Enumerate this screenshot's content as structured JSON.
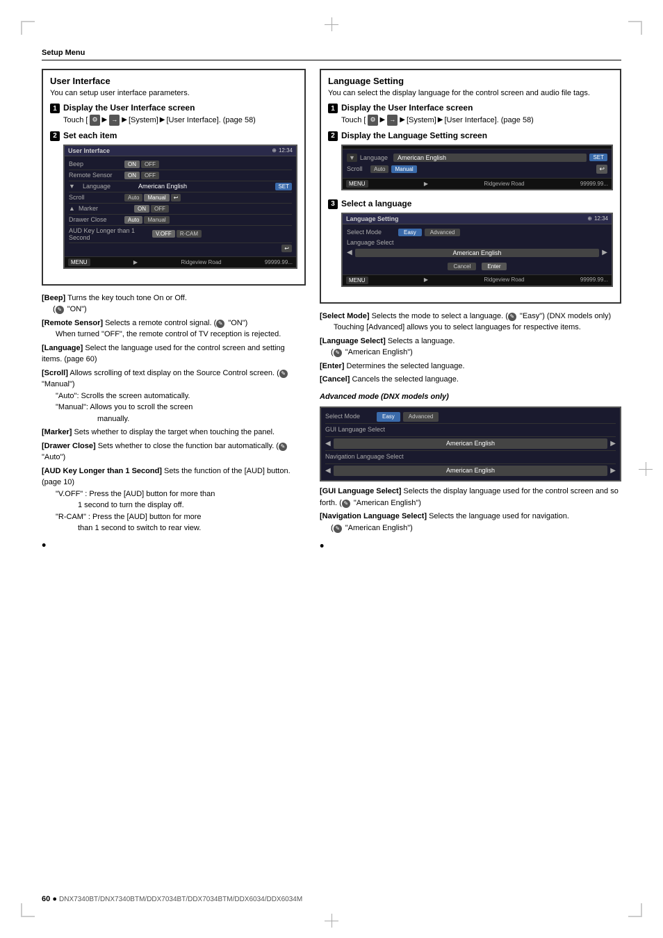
{
  "page": {
    "setup_menu_label": "Setup Menu",
    "page_number": "60",
    "bullet": "●",
    "model_line": "DNX7340BT/DNX7340BTM/DDX7034BT/DDX7034BTM/DDX6034/DDX6034M"
  },
  "left_section": {
    "title": "User Interface",
    "subtitle": "You can setup user interface parameters.",
    "step1": {
      "badge": "1",
      "title": "Display the User Interface screen",
      "touch_label": "Touch [",
      "icon1": "⚙",
      "arrow1": "▶",
      "icon2": "→",
      "arrow2": "▶",
      "system_label": "[System]",
      "arrow3": "▶",
      "interface_label": "[User Interface]. (page 58)"
    },
    "step2": {
      "badge": "2",
      "title": "Set each item",
      "screen": {
        "header_title": "User Interface",
        "header_icon": "⊕",
        "header_clock": "12:34",
        "beep_label": "Beep",
        "beep_on": "ON",
        "beep_off": "OFF",
        "remote_label": "Remote Sensor",
        "remote_on": "ON",
        "remote_off": "OFF",
        "language_label": "Language",
        "language_value": "American English",
        "language_set": "SET",
        "scroll_label": "Scroll",
        "scroll_auto": "Auto",
        "scroll_manual": "Manual",
        "scroll_back": "↩",
        "marker_label": "Marker",
        "marker_on": "ON",
        "marker_off": "OFF",
        "drawer_label": "Drawer Close",
        "drawer_auto": "Auto",
        "drawer_manual": "Manual",
        "aud_label": "AUD Key Longer than 1 Second",
        "aud_voff": "V.OFF",
        "aud_rcam": "R-CAM",
        "footer_menu": "MENU",
        "footer_arrow": "▶",
        "footer_road": "Ridgeview Road",
        "footer_dist": "99999.99..."
      }
    }
  },
  "left_descriptions": {
    "items": [
      {
        "key": "[Beep]",
        "text": "Turns the key touch tone On or Off.",
        "note": "\"ON\")",
        "note_icon": "✎"
      },
      {
        "key": "[Remote Sensor]",
        "text": "Selects a remote control signal.",
        "note": "\"ON\")",
        "note_icon": "✎",
        "extra": "When turned \"OFF\", the remote control of TV reception is rejected."
      },
      {
        "key": "[Language]",
        "text": "Select the language used for the control screen and setting items. (page 60)"
      },
      {
        "key": "[Scroll]",
        "text": "Allows scrolling of text display on the Source Control screen.",
        "note": "\"Manual\")",
        "note_icon": "✎",
        "sub": [
          "\"Auto\":  Scrolls the screen automatically.",
          "\"Manual\":  Allows you to scroll the screen manually."
        ]
      },
      {
        "key": "[Marker]",
        "text": "Sets whether to display the target when touching the panel."
      },
      {
        "key": "[Drawer Close]",
        "text": "Sets whether to close the function bar automatically.",
        "note": "\"Auto\")",
        "note_icon": "✎"
      },
      {
        "key": "[AUD Key Longer than 1 Second]",
        "text": "Sets the function of the [AUD] button. (page 10)",
        "sub": [
          "\"V.OFF\" : Press the [AUD] button for more than 1 second to turn the display off.",
          "\"R-CAM\" : Press the [AUD] button for more than 1 second to switch to rear view."
        ]
      }
    ]
  },
  "right_section": {
    "title": "Language Setting",
    "subtitle": "You can select the display language for the control screen and audio file tags.",
    "step1": {
      "badge": "1",
      "title": "Display the User Interface screen",
      "touch_label": "Touch [",
      "icon1": "⚙",
      "arrow1": "▶",
      "icon2": "→",
      "arrow2": "▶",
      "system_label": "[System]",
      "arrow3": "▶",
      "interface_label": "[User Interface]. (page 58)"
    },
    "step2": {
      "badge": "2",
      "title": "Display the Language Setting screen",
      "screen": {
        "dropdown": "▼",
        "lang_label": "Language",
        "lang_value": "American English",
        "lang_set": "SET",
        "scroll_label": "Scroll",
        "scroll_auto": "Auto",
        "scroll_manual": "Manual",
        "back_btn": "↩",
        "footer_menu": "MENU",
        "footer_arrow": "▶",
        "footer_road": "Ridgeview Road",
        "footer_dist": "99999.99..."
      }
    },
    "step3": {
      "badge": "3",
      "title": "Select a language",
      "screen": {
        "header_title": "Language Setting",
        "header_icon": "⊕",
        "header_clock": "12:34",
        "select_mode_label": "Select Mode",
        "mode_easy": "Easy",
        "mode_advanced": "Advanced",
        "lang_select_label": "Language Select",
        "arrow_left": "◀",
        "lang_value": "American English",
        "arrow_right": "▶",
        "cancel_btn": "Cancel",
        "enter_btn": "Enter",
        "footer_menu": "MENU",
        "footer_arrow": "▶",
        "footer_road": "Ridgeview Road",
        "footer_dist": "99999.99..."
      }
    }
  },
  "right_descriptions": {
    "items": [
      {
        "key": "[Select Mode]",
        "text": "Selects the mode to select a language.",
        "note": "\"Easy\") (DNX models only)",
        "note_icon": "✎",
        "extra": "Touching [Advanced] allows you to select languages for respective items."
      },
      {
        "key": "[Language Select]",
        "text": "Selects a language.",
        "note": "\"American English\")",
        "note_icon": "✎"
      },
      {
        "key": "[Enter]",
        "text": "Determines the selected language."
      },
      {
        "key": "[Cancel]",
        "text": "Cancels the selected language."
      }
    ],
    "advanced_title": "Advanced mode (DNX models only)",
    "advanced_screen": {
      "mode_easy": "Easy",
      "mode_advanced": "Advanced",
      "gui_label": "GUI Language Select",
      "gui_value": "American English",
      "nav_label": "Navigation Language Select",
      "nav_value": "American English"
    },
    "advanced_items": [
      {
        "key": "[GUI Language Select]",
        "text": "Selects the display language used for the control screen and so forth.",
        "note": "\"American English\")",
        "note_icon": "✎"
      },
      {
        "key": "[Navigation Language Select]",
        "text": "Selects the language used for navigation.",
        "note": "\"American English\")",
        "note_icon": "✎"
      }
    ]
  }
}
